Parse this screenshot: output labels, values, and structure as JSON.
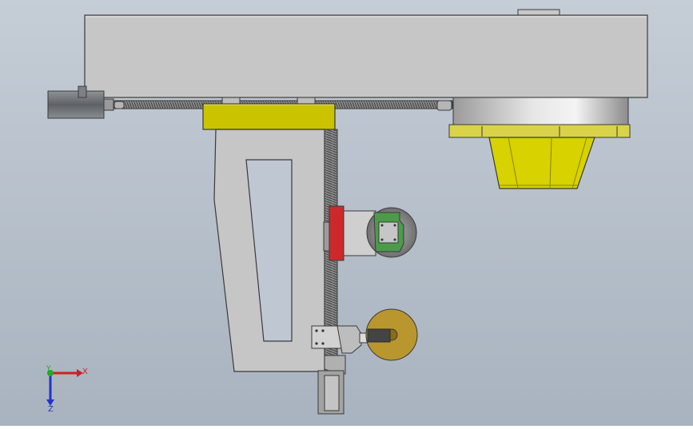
{
  "background": {
    "top_color": "#c5cdd6",
    "bottom_color": "#a8b3bf"
  },
  "colors": {
    "housing": "#c6c6c6",
    "housing_dark": "#a9a9a9",
    "carriage_yellow": "#c9c300",
    "bowl_yellow": "#d7d200",
    "red_block": "#cc2a2a",
    "green_bracket": "#3d8f3d",
    "grinding_wheel": "#8e8e8e",
    "polish_wheel": "#b9962e",
    "outline": "#3a3a3a"
  },
  "view_triad": {
    "x_label": "X",
    "y_label": "Y",
    "z_label": "Z",
    "x_color": "#cc2222",
    "y_color": "#22aa22",
    "z_color": "#2233cc"
  }
}
